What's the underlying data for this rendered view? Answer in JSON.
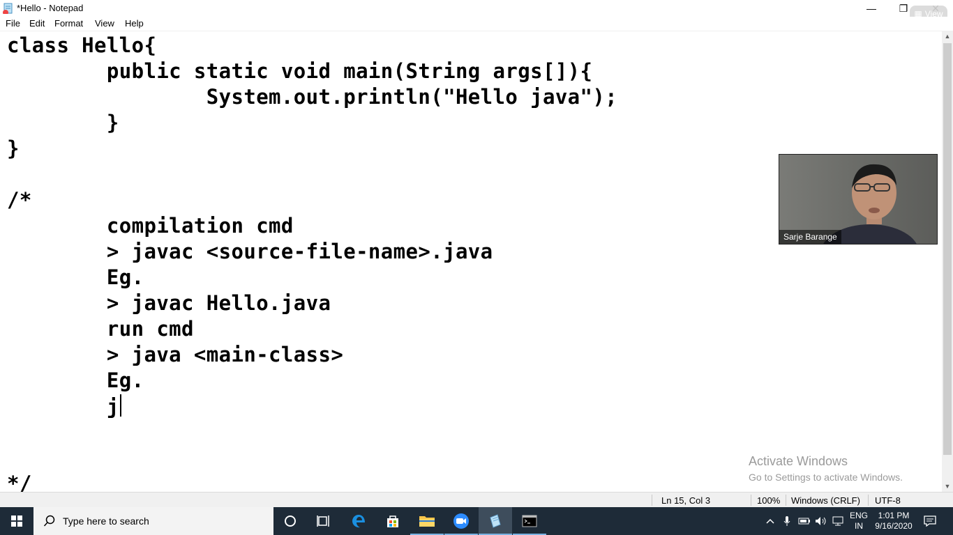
{
  "window": {
    "title": "*Hello - Notepad",
    "minimize_label": "—",
    "restore_label": "❐",
    "close_label": "✕",
    "view_button_label": "View"
  },
  "menu": {
    "file": "File",
    "edit": "Edit",
    "format": "Format",
    "view": "View",
    "help": "Help"
  },
  "editor": {
    "lines": [
      "class Hello{",
      "        public static void main(String args[]){",
      "                System.out.println(\"Hello java\");",
      "        }",
      "}",
      "",
      "/*",
      "        compilation cmd",
      "        > javac <source-file-name>.java",
      "        Eg.",
      "        > javac Hello.java",
      "        run cmd",
      "        > java <main-class>",
      "        Eg.",
      "        j",
      "",
      "",
      "*/"
    ]
  },
  "webcam": {
    "participant_name": "Sarje Barange"
  },
  "watermark": {
    "title": "Activate Windows",
    "subtitle": "Go to Settings to activate Windows."
  },
  "status": {
    "position": "Ln 15, Col 3",
    "zoom": "100%",
    "line_endings": "Windows (CRLF)",
    "encoding": "UTF-8"
  },
  "taskbar": {
    "search_placeholder": "Type here to search",
    "lang_top": "ENG",
    "lang_bottom": "IN",
    "time": "1:01 PM",
    "date": "9/16/2020"
  },
  "colors": {
    "taskbar_bg": "#1e2b38",
    "accent": "#7ab3e3"
  }
}
